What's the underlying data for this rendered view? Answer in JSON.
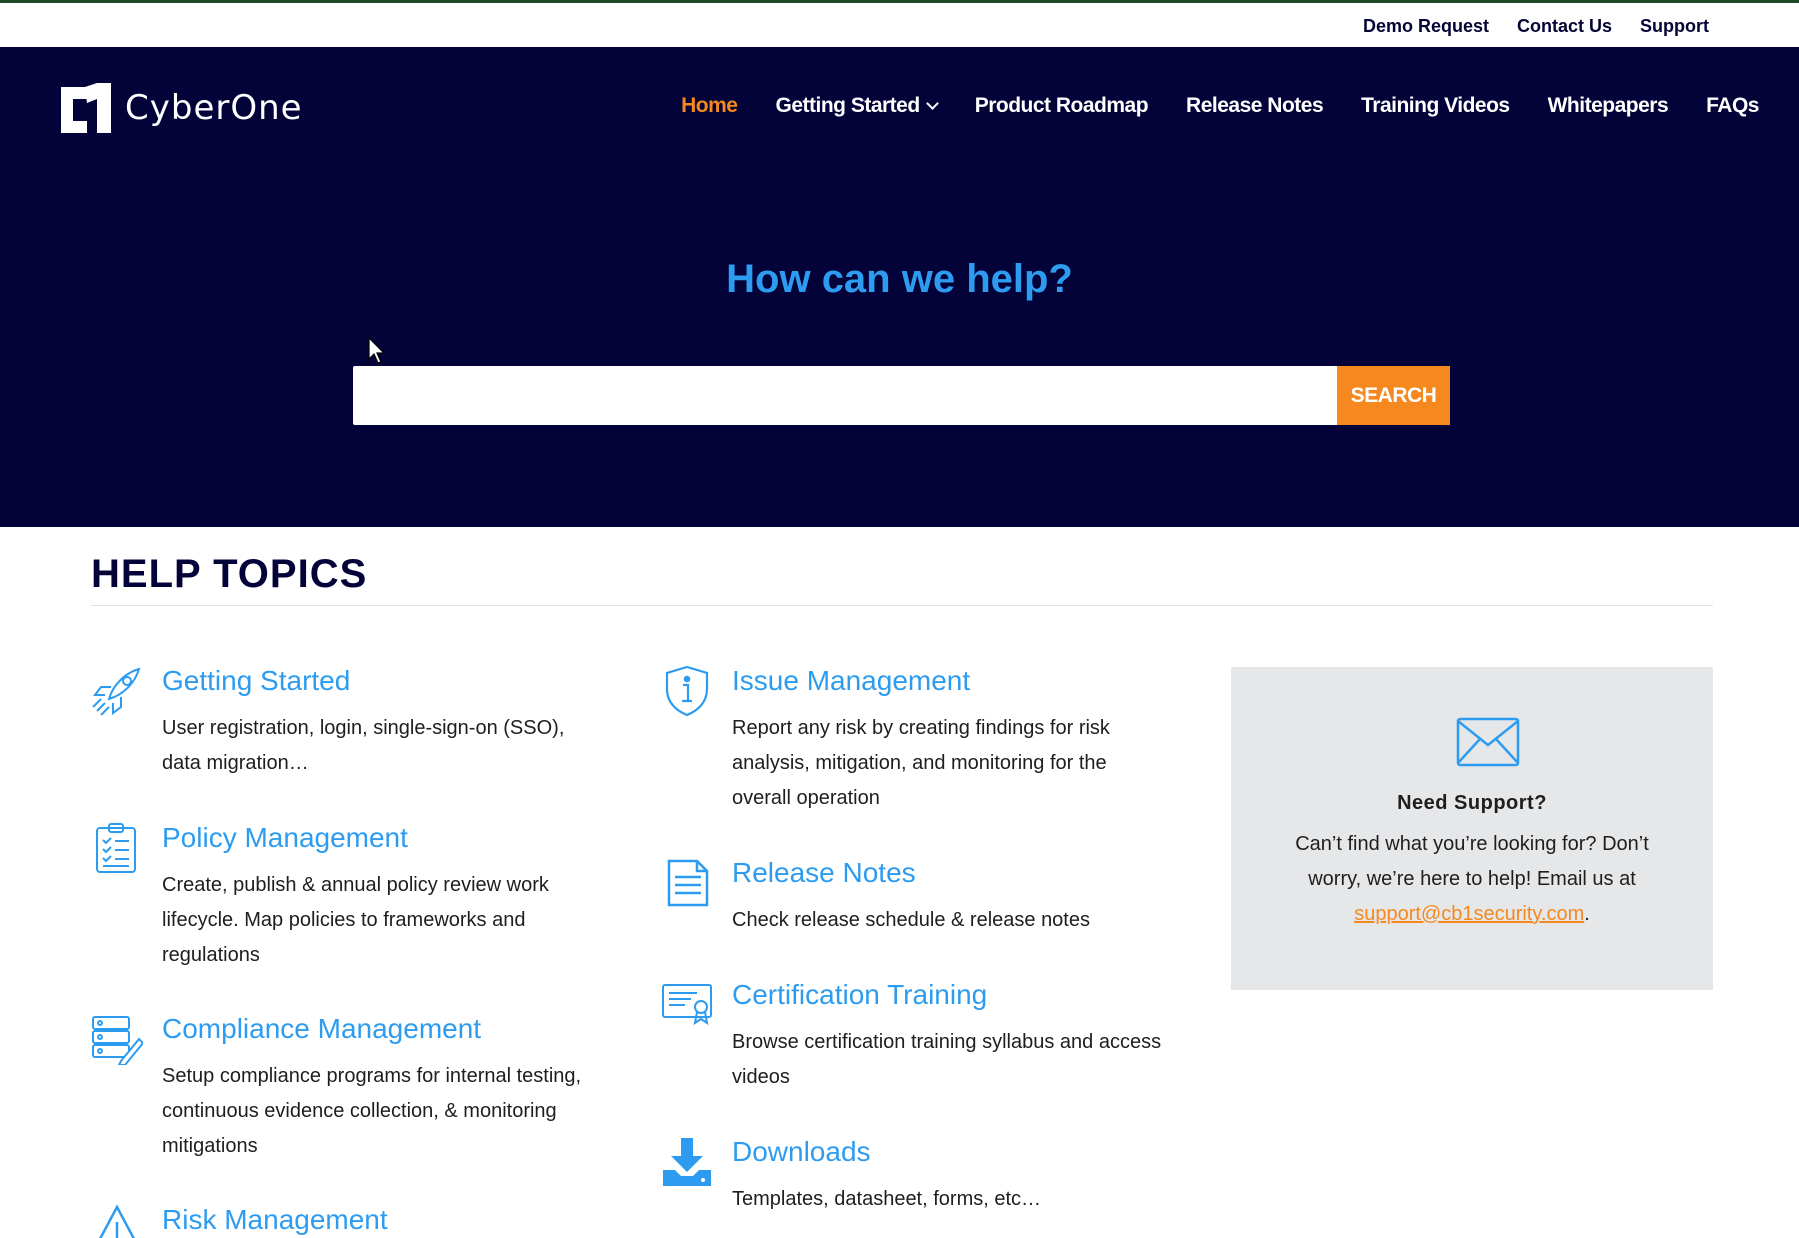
{
  "topbar": {
    "links": [
      "Demo Request",
      "Contact Us",
      "Support"
    ]
  },
  "brand": {
    "name": "CyberOne",
    "logo_icon": "c1-logo-mark"
  },
  "nav": {
    "items": [
      {
        "label": "Home",
        "active": true
      },
      {
        "label": "Getting Started",
        "has_dropdown": true
      },
      {
        "label": "Product Roadmap"
      },
      {
        "label": "Release Notes"
      },
      {
        "label": "Training Videos"
      },
      {
        "label": "Whitepapers"
      },
      {
        "label": "FAQs"
      }
    ]
  },
  "hero": {
    "title": "How can we help?",
    "search_value": "",
    "search_placeholder": "",
    "search_button": "SEARCH"
  },
  "help": {
    "title": "HELP TOPICS",
    "left": [
      {
        "icon": "rocket-icon",
        "title": "Getting Started",
        "desc": "User registration, login, single-sign-on (SSO), data migration…"
      },
      {
        "icon": "clipboard-checklist-icon",
        "title": "Policy Management",
        "desc": "Create, publish & annual policy review work lifecycle. Map policies to frameworks and regulations"
      },
      {
        "icon": "server-edit-icon",
        "title": "Compliance Management",
        "desc": "Setup compliance programs for internal testing, continuous evidence collection, & monitoring mitigations"
      },
      {
        "icon": "warning-triangle-icon",
        "title": "Risk Management",
        "desc": ""
      }
    ],
    "right": [
      {
        "icon": "shield-info-icon",
        "title": "Issue Management",
        "desc": "Report any risk by creating findings for risk analysis, mitigation, and monitoring for the overall operation"
      },
      {
        "icon": "document-lines-icon",
        "title": "Release Notes",
        "desc": "Check release schedule & release notes"
      },
      {
        "icon": "certificate-icon",
        "title": "Certification Training",
        "desc": "Browse certification training syllabus and access videos"
      },
      {
        "icon": "download-icon",
        "title": "Downloads",
        "desc": "Templates, datasheet, forms, etc…"
      }
    ]
  },
  "support": {
    "icon": "envelope-icon",
    "title": "Need Support?",
    "desc": "Can’t find what you’re looking for? Don’t worry, we’re here to help! Email us at",
    "email": "support@cb1security.com",
    "suffix": "."
  },
  "colors": {
    "navy": "#03033a",
    "accent_blue": "#2d9cf0",
    "accent_orange": "#f5891f",
    "support_bg": "#e6e7e9"
  }
}
